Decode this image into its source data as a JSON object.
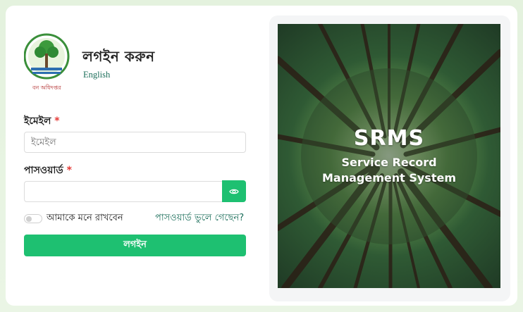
{
  "logo": {
    "caption": "বন অধিদপ্তর"
  },
  "header": {
    "title": "লগইন করুন",
    "language_link": "English"
  },
  "form": {
    "email": {
      "label": "ইমেইল",
      "required_mark": "*",
      "placeholder": "ইমেইল",
      "value": ""
    },
    "password": {
      "label": "পাসওয়ার্ড",
      "required_mark": "*",
      "value": ""
    },
    "remember_me": {
      "label": "আমাকে মনে রাখবেন",
      "checked": false
    },
    "forgot_password": "পাসওয়ার্ড ভুলে গেছেন?",
    "submit": "লগইন"
  },
  "hero": {
    "title": "SRMS",
    "subtitle_line1": "Service Record",
    "subtitle_line2": "Management System"
  },
  "colors": {
    "accent": "#1ec071",
    "link": "#1b6e5a",
    "required": "#e53935"
  },
  "icons": {
    "password_toggle": "eye-icon"
  }
}
